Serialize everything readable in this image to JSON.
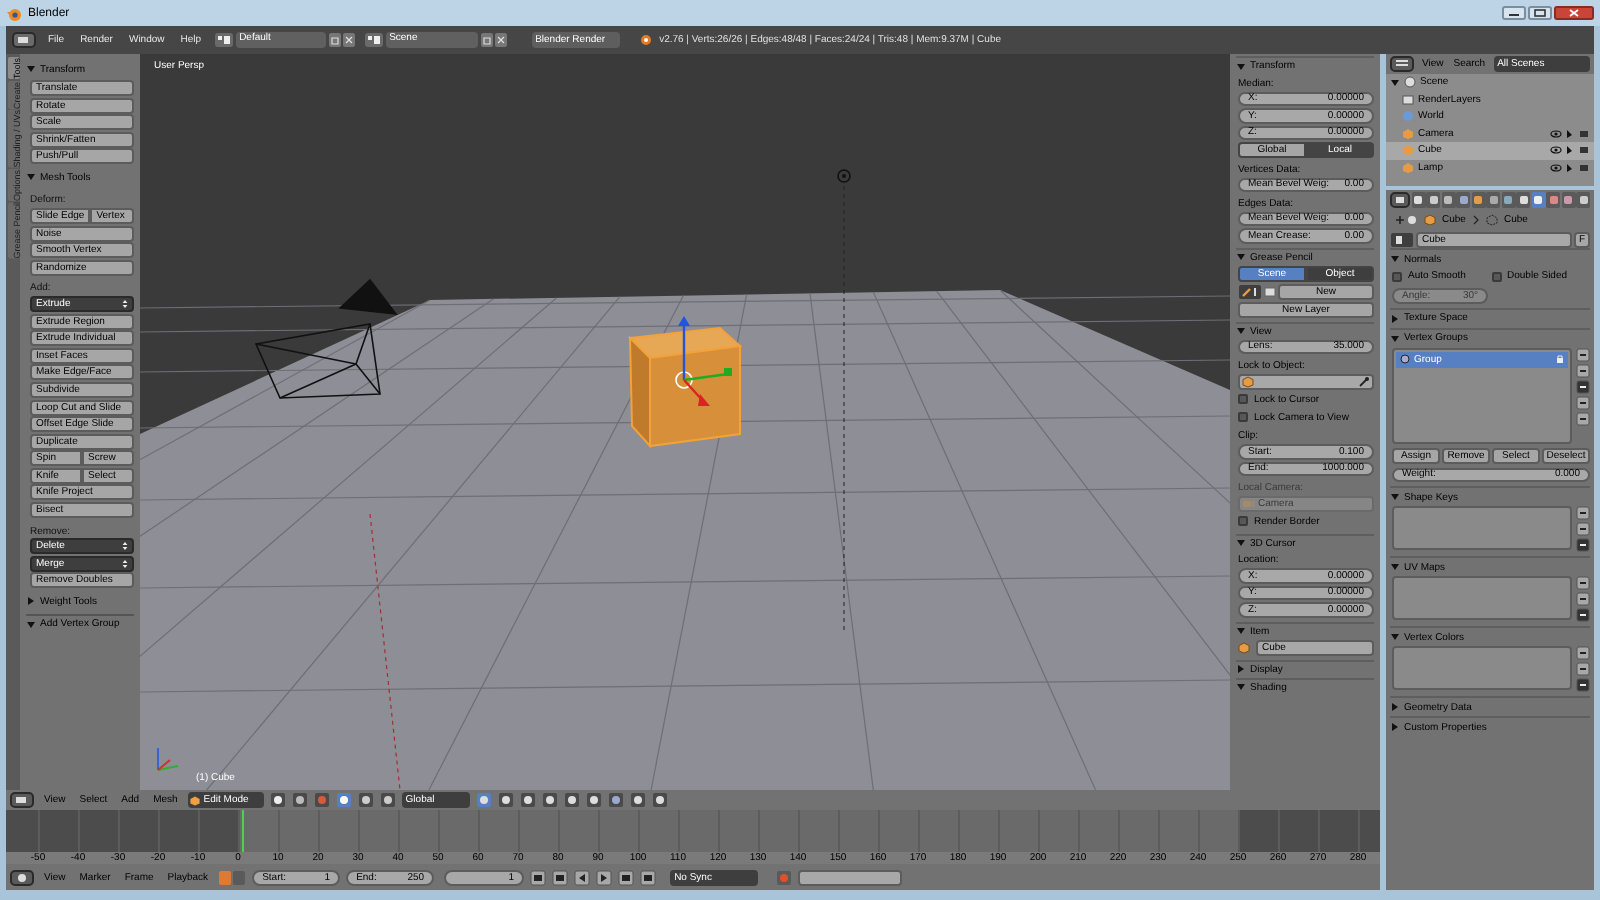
{
  "window": {
    "title": "Blender"
  },
  "info_header": {
    "menus": [
      "File",
      "Render",
      "Window",
      "Help"
    ],
    "screen_layout": "Default",
    "scene": "Scene",
    "render_engine": "Blender Render",
    "stats": "v2.76 | Verts:26/26 | Edges:48/48 | Faces:24/24 | Tris:48 | Mem:9.37M | Cube"
  },
  "tool_tabs": [
    {
      "label": "Tools",
      "selected": true
    },
    {
      "label": "Create",
      "selected": false
    },
    {
      "label": "Shading / UVs",
      "selected": false
    },
    {
      "label": "Options",
      "selected": false
    },
    {
      "label": "Grease Pencil",
      "selected": false
    }
  ],
  "tool_shelf": [
    {
      "title": "Transform",
      "expanded": true,
      "rows": [
        {
          "kind": "buttons",
          "labels": [
            "Translate"
          ]
        },
        {
          "kind": "buttons",
          "labels": [
            "Rotate"
          ]
        },
        {
          "kind": "buttons",
          "labels": [
            "Scale"
          ]
        },
        {
          "kind": "buttons",
          "labels": [
            "Shrink/Fatten"
          ]
        },
        {
          "kind": "buttons",
          "labels": [
            "Push/Pull"
          ]
        }
      ]
    },
    {
      "title": "Mesh Tools",
      "expanded": true,
      "rows": [
        {
          "kind": "label",
          "labels": [
            "Deform:"
          ]
        },
        {
          "kind": "buttons",
          "labels": [
            "Slide Edge",
            "Vertex"
          ]
        },
        {
          "kind": "buttons",
          "labels": [
            "Noise"
          ]
        },
        {
          "kind": "buttons",
          "labels": [
            "Smooth Vertex"
          ]
        },
        {
          "kind": "buttons",
          "labels": [
            "Randomize"
          ]
        },
        {
          "kind": "label",
          "labels": [
            "Add:"
          ]
        },
        {
          "kind": "menu",
          "labels": [
            "Extrude"
          ]
        },
        {
          "kind": "buttons",
          "labels": [
            "Extrude Region"
          ]
        },
        {
          "kind": "buttons",
          "labels": [
            "Extrude Individual"
          ]
        },
        {
          "kind": "buttons",
          "labels": [
            "Inset Faces"
          ]
        },
        {
          "kind": "buttons",
          "labels": [
            "Make Edge/Face"
          ]
        },
        {
          "kind": "buttons",
          "labels": [
            "Subdivide"
          ]
        },
        {
          "kind": "buttons",
          "labels": [
            "Loop Cut and Slide"
          ]
        },
        {
          "kind": "buttons",
          "labels": [
            "Offset Edge Slide"
          ]
        },
        {
          "kind": "buttons",
          "labels": [
            "Duplicate"
          ]
        },
        {
          "kind": "buttons",
          "labels": [
            "Spin",
            "Screw"
          ]
        },
        {
          "kind": "buttons",
          "labels": [
            "Knife",
            "Select"
          ]
        },
        {
          "kind": "buttons",
          "labels": [
            "Knife Project"
          ]
        },
        {
          "kind": "buttons",
          "labels": [
            "Bisect"
          ]
        },
        {
          "kind": "label",
          "labels": [
            "Remove:"
          ]
        },
        {
          "kind": "menu",
          "labels": [
            "Delete"
          ]
        },
        {
          "kind": "menu",
          "labels": [
            "Merge"
          ]
        },
        {
          "kind": "buttons",
          "labels": [
            "Remove Doubles"
          ]
        }
      ]
    },
    {
      "title": "Weight Tools",
      "expanded": false
    }
  ],
  "operator_panel": {
    "title": "Add Vertex Group",
    "expanded": true
  },
  "viewport": {
    "view_name": "User Persp",
    "object_label": "(1) Cube"
  },
  "viewport_header": {
    "menus": [
      "View",
      "Select",
      "Add",
      "Mesh"
    ],
    "mode": "Edit Mode",
    "orientation": "Global"
  },
  "properties_shelf": [
    {
      "title": "Transform",
      "expanded": true,
      "rows": [
        {
          "kind": "label",
          "text": "Median:"
        },
        {
          "kind": "number",
          "label": "X:",
          "value": "0.00000"
        },
        {
          "kind": "number",
          "label": "Y:",
          "value": "0.00000"
        },
        {
          "kind": "number",
          "label": "Z:",
          "value": "0.00000"
        },
        {
          "kind": "toggle",
          "options": [
            {
              "label": "Global",
              "selected": false
            },
            {
              "label": "Local",
              "selected": true
            }
          ]
        },
        {
          "kind": "label",
          "text": "Vertices Data:"
        },
        {
          "kind": "number",
          "label": "Mean Bevel Weig:",
          "value": "0.00"
        },
        {
          "kind": "label",
          "text": "Edges Data:"
        },
        {
          "kind": "number",
          "label": "Mean Bevel Weig:",
          "value": "0.00"
        },
        {
          "kind": "number",
          "label": "Mean Crease:",
          "value": "0.00"
        }
      ]
    },
    {
      "title": "Grease Pencil",
      "expanded": true,
      "rows": [
        {
          "kind": "tabs",
          "options": [
            {
              "label": "Scene",
              "selected": true
            },
            {
              "label": "Object",
              "selected": false
            }
          ]
        },
        {
          "kind": "new",
          "text": "New"
        },
        {
          "kind": "button",
          "text": "New Layer"
        }
      ]
    },
    {
      "title": "View",
      "expanded": true,
      "rows": [
        {
          "kind": "number",
          "label": "Lens:",
          "value": "35.000"
        },
        {
          "kind": "label",
          "text": "Lock to Object:"
        },
        {
          "kind": "object_field"
        },
        {
          "kind": "checkbox",
          "text": "Lock to Cursor",
          "checked": false
        },
        {
          "kind": "checkbox",
          "text": "Lock Camera to View",
          "checked": false
        },
        {
          "kind": "label",
          "text": "Clip:"
        },
        {
          "kind": "number",
          "label": "Start:",
          "value": "0.100"
        },
        {
          "kind": "number",
          "label": "End:",
          "value": "1000.000"
        },
        {
          "kind": "dim_label",
          "text": "Local Camera:"
        },
        {
          "kind": "dim_field",
          "text": "Camera"
        },
        {
          "kind": "checkbox",
          "text": "Render Border",
          "checked": false
        }
      ]
    },
    {
      "title": "3D Cursor",
      "expanded": true,
      "rows": [
        {
          "kind": "label",
          "text": "Location:"
        },
        {
          "kind": "number",
          "label": "X:",
          "value": "0.00000"
        },
        {
          "kind": "number",
          "label": "Y:",
          "value": "0.00000"
        },
        {
          "kind": "number",
          "label": "Z:",
          "value": "0.00000"
        }
      ]
    },
    {
      "title": "Item",
      "expanded": true,
      "rows": [
        {
          "kind": "name_field",
          "text": "Cube"
        }
      ]
    },
    {
      "title": "Display",
      "expanded": false
    },
    {
      "title": "Shading",
      "expanded": true
    }
  ],
  "outliner": {
    "menus": [
      "View",
      "Search"
    ],
    "filter": "All Scenes",
    "tree": [
      {
        "label": "Scene",
        "kind": "scene",
        "selected": false,
        "expanded": true,
        "children": [
          {
            "label": "RenderLayers",
            "kind": "renderlayers",
            "selected": false
          },
          {
            "label": "World",
            "kind": "world",
            "selected": false
          },
          {
            "label": "Camera",
            "kind": "object",
            "selected": false
          },
          {
            "label": "Cube",
            "kind": "object",
            "selected": true
          },
          {
            "label": "Lamp",
            "kind": "object",
            "selected": false
          }
        ]
      }
    ]
  },
  "properties_tabs": [
    {
      "selected": false
    },
    {
      "selected": false
    },
    {
      "selected": false
    },
    {
      "selected": false
    },
    {
      "selected": false
    },
    {
      "selected": false
    },
    {
      "selected": false
    },
    {
      "selected": false
    },
    {
      "selected": true
    },
    {
      "selected": false
    },
    {
      "selected": false
    },
    {
      "selected": false
    }
  ],
  "properties": {
    "breadcrumb": [
      "Cube",
      "Cube"
    ],
    "datablock": "Cube",
    "fake_user": "F",
    "panels": [
      {
        "title": "Normals",
        "expanded": true,
        "rows": [
          {
            "kind": "checkboxes",
            "items": [
              {
                "label": "Auto Smooth",
                "checked": false
              },
              {
                "label": "Double Sided",
                "checked": false
              }
            ]
          },
          {
            "kind": "dim_number",
            "label": "Angle:",
            "value": "30°"
          }
        ]
      },
      {
        "title": "Texture Space",
        "expanded": false
      },
      {
        "title": "Vertex Groups",
        "expanded": true,
        "rows": [
          {
            "kind": "list",
            "items": [
              {
                "label": "Group",
                "selected": true
              }
            ]
          },
          {
            "kind": "buttons",
            "labels": [
              "Assign",
              "Remove",
              "Select",
              "Deselect"
            ]
          },
          {
            "kind": "number",
            "label": "Weight:",
            "value": "0.000"
          }
        ]
      },
      {
        "title": "Shape Keys",
        "expanded": true,
        "rows": [
          {
            "kind": "empty_list"
          }
        ]
      },
      {
        "title": "UV Maps",
        "expanded": true,
        "rows": [
          {
            "kind": "empty_list"
          }
        ]
      },
      {
        "title": "Vertex Colors",
        "expanded": true,
        "rows": [
          {
            "kind": "empty_list"
          }
        ]
      },
      {
        "title": "Geometry Data",
        "expanded": false
      },
      {
        "title": "Custom Properties",
        "expanded": false
      }
    ]
  },
  "timeline": {
    "ruler": [
      "-50",
      "-40",
      "-30",
      "-20",
      "-10",
      "0",
      "10",
      "20",
      "30",
      "40",
      "50",
      "60",
      "70",
      "80",
      "90",
      "100",
      "110",
      "120",
      "130",
      "140",
      "150",
      "160",
      "170",
      "180",
      "190",
      "200",
      "210",
      "220",
      "230",
      "240",
      "250",
      "260",
      "270",
      "280"
    ],
    "menus": [
      "View",
      "Marker",
      "Frame",
      "Playback"
    ],
    "start_label": "Start:",
    "start": "1",
    "end_label": "End:",
    "end": "250",
    "current_frame": "1",
    "sync": "No Sync"
  }
}
